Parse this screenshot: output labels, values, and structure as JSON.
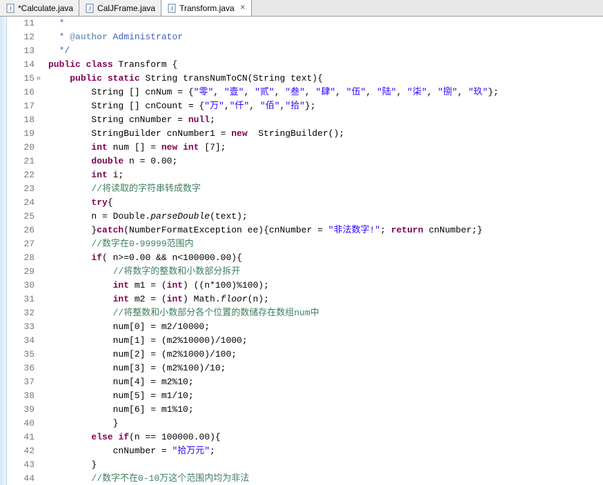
{
  "tabs": [
    {
      "label": "*Calculate.java",
      "active": false
    },
    {
      "label": "CalJFrame.java",
      "active": false
    },
    {
      "label": "Transform.java",
      "active": true
    }
  ],
  "lines": [
    {
      "num": "11",
      "marker": "",
      "segments": [
        {
          "cls": "jdoc",
          "text": "  *"
        }
      ]
    },
    {
      "num": "12",
      "marker": "",
      "segments": [
        {
          "cls": "jdoc",
          "text": "  * "
        },
        {
          "cls": "jdoctag",
          "text": "@author"
        },
        {
          "cls": "jdoc",
          "text": " Administrator"
        }
      ]
    },
    {
      "num": "13",
      "marker": "",
      "segments": [
        {
          "cls": "jdoc",
          "text": "  */"
        }
      ]
    },
    {
      "num": "14",
      "marker": "",
      "segments": [
        {
          "cls": "kw",
          "text": "public"
        },
        {
          "cls": "",
          "text": " "
        },
        {
          "cls": "kw",
          "text": "class"
        },
        {
          "cls": "",
          "text": " Transform {"
        }
      ]
    },
    {
      "num": "15",
      "marker": "⊖",
      "segments": [
        {
          "cls": "",
          "text": "    "
        },
        {
          "cls": "kw",
          "text": "public"
        },
        {
          "cls": "",
          "text": " "
        },
        {
          "cls": "kw",
          "text": "static"
        },
        {
          "cls": "",
          "text": " String transNumToCN(String text){"
        }
      ]
    },
    {
      "num": "16",
      "marker": "",
      "segments": [
        {
          "cls": "",
          "text": "        String [] cnNum = {"
        },
        {
          "cls": "str",
          "text": "\"零\""
        },
        {
          "cls": "",
          "text": ", "
        },
        {
          "cls": "str",
          "text": "\"壹\""
        },
        {
          "cls": "",
          "text": ", "
        },
        {
          "cls": "str",
          "text": "\"贰\""
        },
        {
          "cls": "",
          "text": ", "
        },
        {
          "cls": "str",
          "text": "\"叁\""
        },
        {
          "cls": "",
          "text": ", "
        },
        {
          "cls": "str",
          "text": "\"肆\""
        },
        {
          "cls": "",
          "text": ", "
        },
        {
          "cls": "str",
          "text": "\"伍\""
        },
        {
          "cls": "",
          "text": ", "
        },
        {
          "cls": "str",
          "text": "\"陆\""
        },
        {
          "cls": "",
          "text": ", "
        },
        {
          "cls": "str",
          "text": "\"柒\""
        },
        {
          "cls": "",
          "text": ", "
        },
        {
          "cls": "str",
          "text": "\"捌\""
        },
        {
          "cls": "",
          "text": ", "
        },
        {
          "cls": "str",
          "text": "\"玖\""
        },
        {
          "cls": "",
          "text": "};"
        }
      ]
    },
    {
      "num": "17",
      "marker": "",
      "segments": [
        {
          "cls": "",
          "text": "        String [] cnCount = {"
        },
        {
          "cls": "str",
          "text": "\"万\""
        },
        {
          "cls": "",
          "text": ","
        },
        {
          "cls": "str",
          "text": "\"仟\""
        },
        {
          "cls": "",
          "text": ", "
        },
        {
          "cls": "str",
          "text": "\"佰\""
        },
        {
          "cls": "",
          "text": ","
        },
        {
          "cls": "str",
          "text": "\"拾\""
        },
        {
          "cls": "",
          "text": "};"
        }
      ]
    },
    {
      "num": "18",
      "marker": "",
      "segments": [
        {
          "cls": "",
          "text": "        String cnNumber = "
        },
        {
          "cls": "kw",
          "text": "null"
        },
        {
          "cls": "",
          "text": ";"
        }
      ]
    },
    {
      "num": "19",
      "marker": "",
      "segments": [
        {
          "cls": "",
          "text": "        StringBuilder cnNumber1 = "
        },
        {
          "cls": "kw",
          "text": "new"
        },
        {
          "cls": "",
          "text": "  StringBuilder();"
        }
      ]
    },
    {
      "num": "20",
      "marker": "",
      "segments": [
        {
          "cls": "",
          "text": "        "
        },
        {
          "cls": "kw",
          "text": "int"
        },
        {
          "cls": "",
          "text": " num [] = "
        },
        {
          "cls": "kw",
          "text": "new"
        },
        {
          "cls": "",
          "text": " "
        },
        {
          "cls": "kw",
          "text": "int"
        },
        {
          "cls": "",
          "text": " [7];"
        }
      ]
    },
    {
      "num": "21",
      "marker": "",
      "segments": [
        {
          "cls": "",
          "text": "        "
        },
        {
          "cls": "kw",
          "text": "double"
        },
        {
          "cls": "",
          "text": " n = 0.00;"
        }
      ]
    },
    {
      "num": "22",
      "marker": "",
      "segments": [
        {
          "cls": "",
          "text": "        "
        },
        {
          "cls": "kw",
          "text": "int"
        },
        {
          "cls": "",
          "text": " i;"
        }
      ]
    },
    {
      "num": "23",
      "marker": "",
      "segments": [
        {
          "cls": "",
          "text": "        "
        },
        {
          "cls": "cm",
          "text": "//将读取的字符串转成数字"
        }
      ]
    },
    {
      "num": "24",
      "marker": "",
      "segments": [
        {
          "cls": "",
          "text": "        "
        },
        {
          "cls": "kw",
          "text": "try"
        },
        {
          "cls": "",
          "text": "{"
        }
      ]
    },
    {
      "num": "25",
      "marker": "",
      "segments": [
        {
          "cls": "",
          "text": "        n = Double."
        },
        {
          "cls": "method-italic",
          "text": "parseDouble"
        },
        {
          "cls": "",
          "text": "(text);"
        }
      ]
    },
    {
      "num": "26",
      "marker": "",
      "segments": [
        {
          "cls": "",
          "text": "        }"
        },
        {
          "cls": "kw",
          "text": "catch"
        },
        {
          "cls": "",
          "text": "(NumberFormatException ee){cnNumber = "
        },
        {
          "cls": "str",
          "text": "\"非法数字!\""
        },
        {
          "cls": "",
          "text": "; "
        },
        {
          "cls": "kw",
          "text": "return"
        },
        {
          "cls": "",
          "text": " cnNumber;}"
        }
      ]
    },
    {
      "num": "27",
      "marker": "",
      "segments": [
        {
          "cls": "",
          "text": "        "
        },
        {
          "cls": "cm",
          "text": "//数字在0-99999范围内"
        }
      ]
    },
    {
      "num": "28",
      "marker": "",
      "segments": [
        {
          "cls": "",
          "text": "        "
        },
        {
          "cls": "kw",
          "text": "if"
        },
        {
          "cls": "",
          "text": "( n>=0.00 && n<100000.00){"
        }
      ]
    },
    {
      "num": "29",
      "marker": "",
      "segments": [
        {
          "cls": "",
          "text": "            "
        },
        {
          "cls": "cm",
          "text": "//将数字的整数和小数部分拆开"
        }
      ]
    },
    {
      "num": "30",
      "marker": "",
      "segments": [
        {
          "cls": "",
          "text": "            "
        },
        {
          "cls": "kw",
          "text": "int"
        },
        {
          "cls": "",
          "text": " m1 = ("
        },
        {
          "cls": "kw",
          "text": "int"
        },
        {
          "cls": "",
          "text": ") ((n*100)%100);"
        }
      ]
    },
    {
      "num": "31",
      "marker": "",
      "segments": [
        {
          "cls": "",
          "text": "            "
        },
        {
          "cls": "kw",
          "text": "int"
        },
        {
          "cls": "",
          "text": " m2 = ("
        },
        {
          "cls": "kw",
          "text": "int"
        },
        {
          "cls": "",
          "text": ") Math."
        },
        {
          "cls": "method-italic",
          "text": "floor"
        },
        {
          "cls": "",
          "text": "(n);"
        }
      ]
    },
    {
      "num": "32",
      "marker": "",
      "segments": [
        {
          "cls": "",
          "text": "            "
        },
        {
          "cls": "cm",
          "text": "//将整数和小数部分各个位置的数储存在数组num中"
        }
      ]
    },
    {
      "num": "33",
      "marker": "",
      "segments": [
        {
          "cls": "",
          "text": "            num[0] = m2/10000;"
        }
      ]
    },
    {
      "num": "34",
      "marker": "",
      "segments": [
        {
          "cls": "",
          "text": "            num[1] = (m2%10000)/1000;"
        }
      ]
    },
    {
      "num": "35",
      "marker": "",
      "segments": [
        {
          "cls": "",
          "text": "            num[2] = (m2%1000)/100;"
        }
      ]
    },
    {
      "num": "36",
      "marker": "",
      "segments": [
        {
          "cls": "",
          "text": "            num[3] = (m2%100)/10;"
        }
      ]
    },
    {
      "num": "37",
      "marker": "",
      "segments": [
        {
          "cls": "",
          "text": "            num[4] = m2%10;"
        }
      ]
    },
    {
      "num": "38",
      "marker": "",
      "segments": [
        {
          "cls": "",
          "text": "            num[5] = m1/10;"
        }
      ]
    },
    {
      "num": "39",
      "marker": "",
      "segments": [
        {
          "cls": "",
          "text": "            num[6] = m1%10;"
        }
      ]
    },
    {
      "num": "40",
      "marker": "",
      "segments": [
        {
          "cls": "",
          "text": "            }"
        }
      ]
    },
    {
      "num": "41",
      "marker": "",
      "segments": [
        {
          "cls": "",
          "text": "        "
        },
        {
          "cls": "kw",
          "text": "else"
        },
        {
          "cls": "",
          "text": " "
        },
        {
          "cls": "kw",
          "text": "if"
        },
        {
          "cls": "",
          "text": "(n == 100000.00){"
        }
      ]
    },
    {
      "num": "42",
      "marker": "",
      "segments": [
        {
          "cls": "",
          "text": "            cnNumber = "
        },
        {
          "cls": "str",
          "text": "\"拾万元\""
        },
        {
          "cls": "",
          "text": ";"
        }
      ]
    },
    {
      "num": "43",
      "marker": "",
      "segments": [
        {
          "cls": "",
          "text": "        }"
        }
      ]
    },
    {
      "num": "44",
      "marker": "",
      "segments": [
        {
          "cls": "",
          "text": "        "
        },
        {
          "cls": "cm",
          "text": "//数字不在0-10万这个范围内均为非法"
        }
      ]
    }
  ]
}
